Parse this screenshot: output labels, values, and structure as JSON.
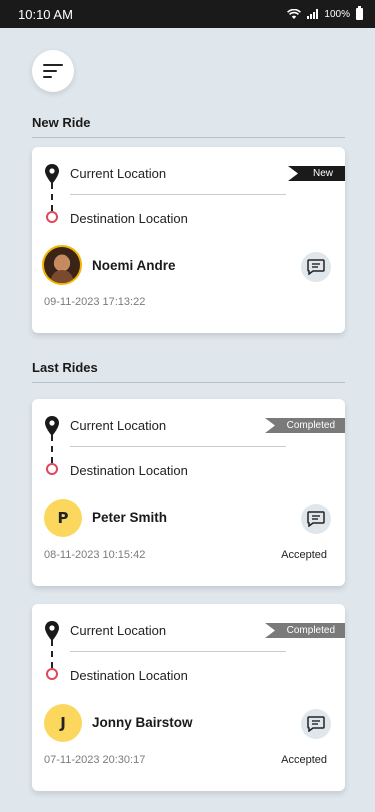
{
  "status_bar": {
    "time": "10:10 AM",
    "battery": "100%"
  },
  "menu": {
    "icon": "menu-icon"
  },
  "sections": {
    "new_ride": "New Ride",
    "last_rides": "Last Rides"
  },
  "rides": [
    {
      "badge": "New",
      "current_location": "Current Location",
      "destination_location": "Destination Location",
      "rider_name": "Noemi Andre",
      "avatar_letter": "",
      "timestamp": "09-11-2023  17:13:22",
      "status": ""
    },
    {
      "badge": "Completed",
      "current_location": "Current Location",
      "destination_location": "Destination Location",
      "rider_name": "Peter Smith",
      "avatar_letter": "P",
      "timestamp": "08-11-2023  10:15:42",
      "status": "Accepted"
    },
    {
      "badge": "Completed",
      "current_location": "Current Location",
      "destination_location": "Destination Location",
      "rider_name": "Jonny Bairstow",
      "avatar_letter": "J",
      "timestamp": "07-11-2023  20:30:17",
      "status": "Accepted"
    }
  ],
  "colors": {
    "background": "#dfe6ec",
    "new_badge": "#1a1a1a",
    "completed_badge": "#7a7a7a",
    "destination_dot": "#e0475a",
    "avatar_yellow": "#fbd85d"
  }
}
